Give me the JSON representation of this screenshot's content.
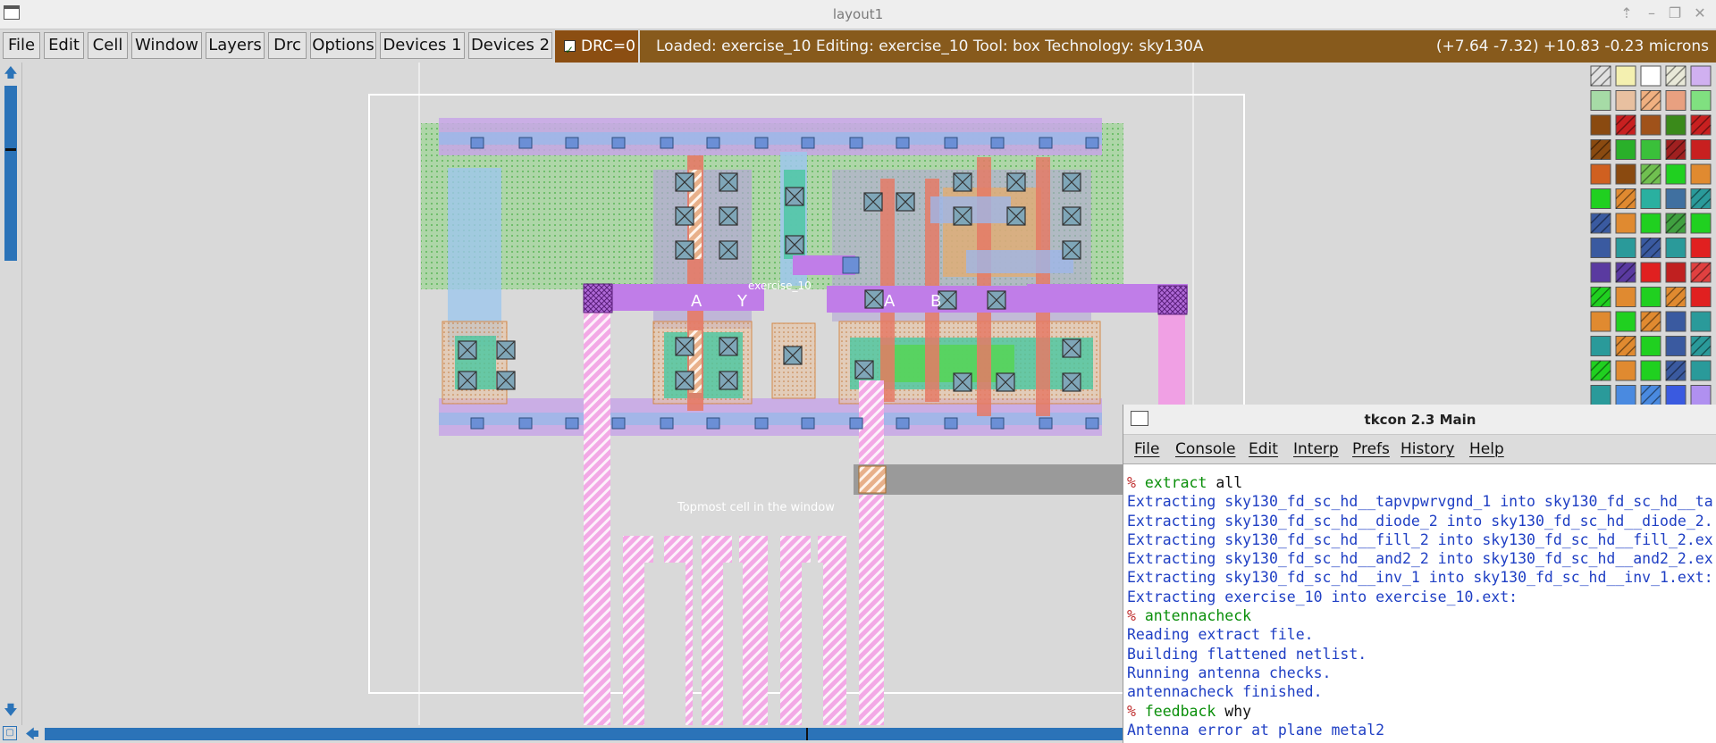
{
  "window": {
    "title": "layout1"
  },
  "menubar": {
    "items": [
      "File",
      "Edit",
      "Cell",
      "Window",
      "Layers",
      "Drc",
      "Options",
      "Devices 1",
      "Devices 2"
    ],
    "drc_label": "DRC=0",
    "status_text": "Loaded: exercise_10 Editing: exercise_10 Tool: box  Technology: sky130A",
    "coords_text": "(+7.64 -7.32) +10.83 -0.23 microns"
  },
  "layout": {
    "cell_name": "exercise_10",
    "topmost_label": "Topmost cell in the window",
    "pin_labels": [
      "A",
      "Y",
      "A",
      "B"
    ]
  },
  "tkcon": {
    "title": "tkcon 2.3 Main",
    "menu": [
      "File",
      "Console",
      "Edit",
      "Interp",
      "Prefs",
      "History",
      "Help"
    ],
    "lines": [
      {
        "type": "cmd",
        "cmd": "extract",
        "arg": "all"
      },
      {
        "type": "out",
        "text": "Extracting sky130_fd_sc_hd__tapvpwrvgnd_1 into sky130_fd_sc_hd__ta"
      },
      {
        "type": "out",
        "text": "Extracting sky130_fd_sc_hd__diode_2 into sky130_fd_sc_hd__diode_2."
      },
      {
        "type": "out",
        "text": "Extracting sky130_fd_sc_hd__fill_2 into sky130_fd_sc_hd__fill_2.ex"
      },
      {
        "type": "out",
        "text": "Extracting sky130_fd_sc_hd__and2_2 into sky130_fd_sc_hd__and2_2.ex"
      },
      {
        "type": "out",
        "text": "Extracting sky130_fd_sc_hd__inv_1 into sky130_fd_sc_hd__inv_1.ext:"
      },
      {
        "type": "out",
        "text": "Extracting exercise_10 into exercise_10.ext:"
      },
      {
        "type": "cmd",
        "cmd": "antennacheck",
        "arg": ""
      },
      {
        "type": "out",
        "text": "Reading extract file."
      },
      {
        "type": "out",
        "text": "Building flattened netlist."
      },
      {
        "type": "out",
        "text": "Running antenna checks."
      },
      {
        "type": "out",
        "text": "antennacheck finished."
      },
      {
        "type": "cmd",
        "cmd": "feedback",
        "arg": "why"
      },
      {
        "type": "out",
        "text": "Antenna error at plane metal2"
      }
    ]
  },
  "colors": {
    "status_bar": "#875a1c",
    "drc_bg": "#8b4e12",
    "console_output": "#1f3fc4",
    "console_command": "#0a8f0a",
    "scrollbar": "#2b73b8"
  }
}
